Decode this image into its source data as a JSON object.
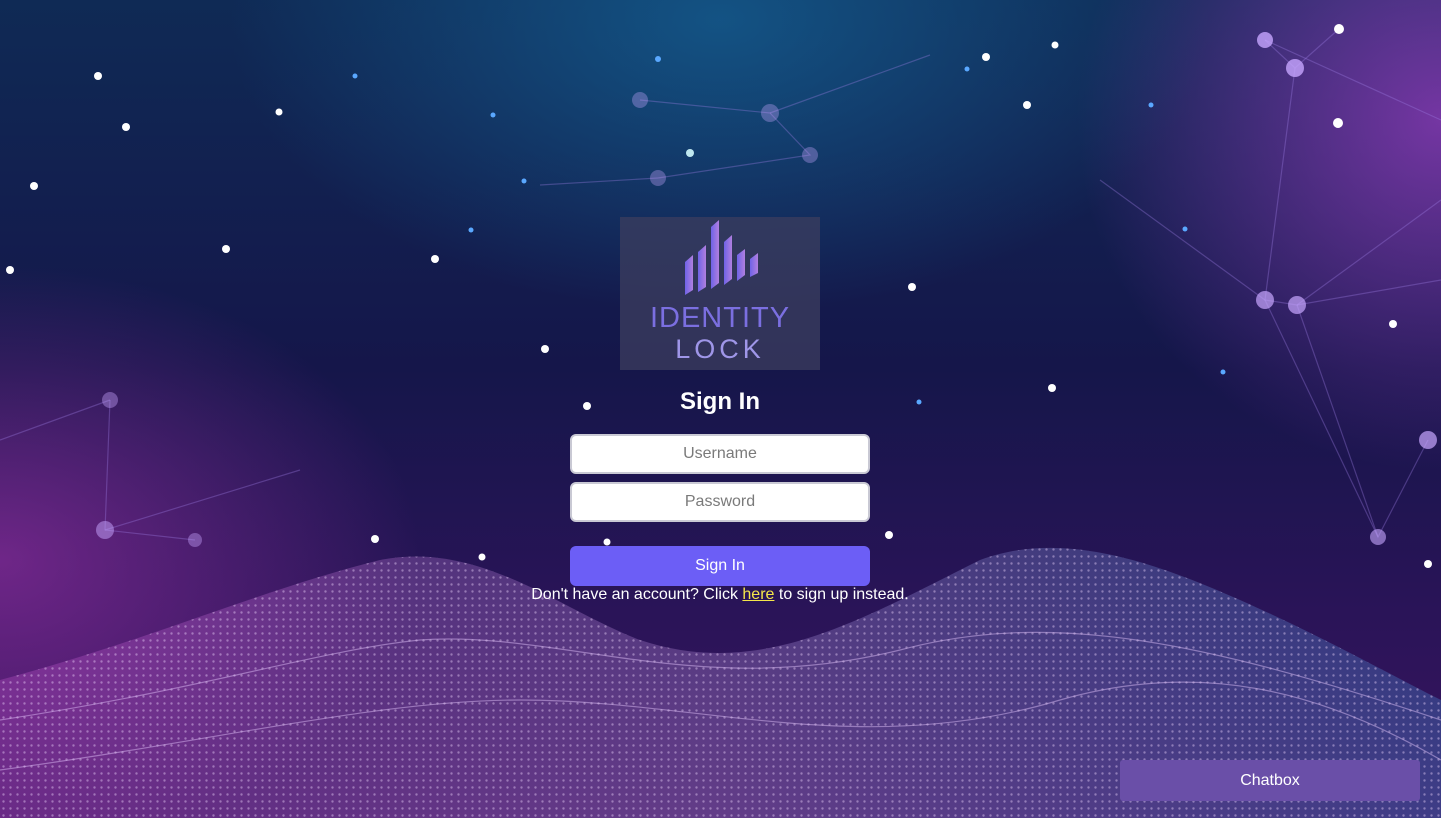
{
  "logo": {
    "line1": "IDENTITY",
    "line2": "LOCK",
    "color_primary": "#7b6fe0",
    "color_secondary": "#9f96e8"
  },
  "form": {
    "title": "Sign In",
    "username_placeholder": "Username",
    "password_placeholder": "Password",
    "submit_label": "Sign In",
    "signup_prefix": "Don't have an account? Click ",
    "signup_link": "here",
    "signup_suffix": " to sign up instead."
  },
  "chatbox": {
    "label": "Chatbox"
  },
  "colors": {
    "accent": "#6c5ef6",
    "link": "#f5e64a",
    "chatbox": "#6a4fa8"
  }
}
